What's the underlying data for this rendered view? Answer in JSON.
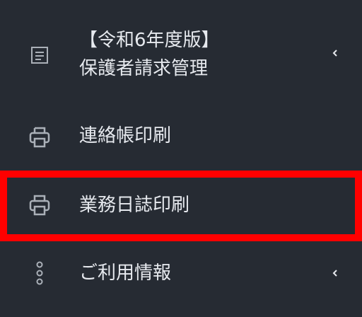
{
  "menu": {
    "items": [
      {
        "id": "billing",
        "label_line1": "【令和6年度版】",
        "label_line2": "保護者請求管理",
        "icon": "document-icon",
        "has_chevron": true
      },
      {
        "id": "contact",
        "label": "連絡帳印刷",
        "icon": "printer-icon",
        "has_chevron": false
      },
      {
        "id": "journal",
        "label": "業務日誌印刷",
        "icon": "printer-icon",
        "has_chevron": false,
        "highlighted": true
      },
      {
        "id": "info",
        "label": "ご利用情報",
        "icon": "vertical-dots-icon",
        "has_chevron": true
      }
    ]
  },
  "colors": {
    "background": "#262b33",
    "text": "#e6e9ee",
    "icon": "#aab0b8",
    "highlight": "#ff0000"
  }
}
